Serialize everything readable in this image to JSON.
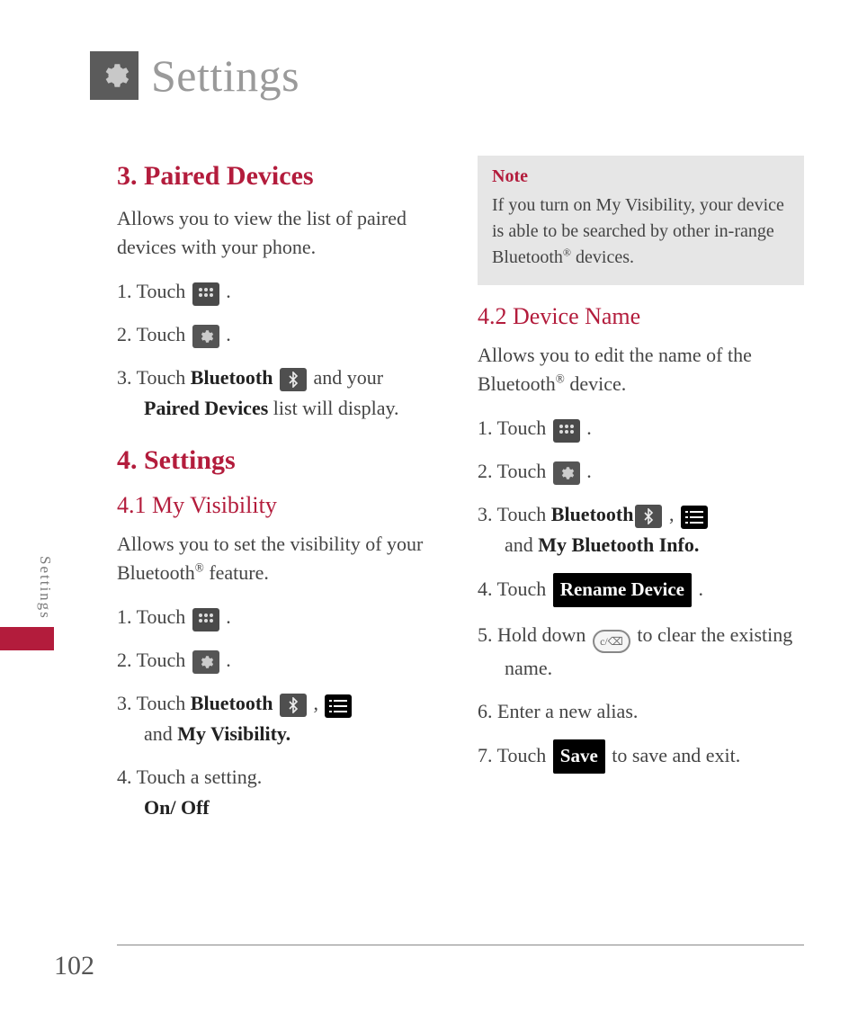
{
  "header": {
    "title": "Settings"
  },
  "sideTab": {
    "label": "Settings"
  },
  "pageNumber": "102",
  "left": {
    "section3": {
      "heading": "3. Paired Devices",
      "intro": "Allows you to view the list of paired devices with your phone.",
      "step1_a": "Touch ",
      "step1_b": " .",
      "step2_a": "Touch ",
      "step2_b": " .",
      "step3_a": "Touch ",
      "step3_bold1": "Bluetooth",
      "step3_b": " and your ",
      "step3_bold2": "Paired Devices",
      "step3_c": " list will display."
    },
    "section4": {
      "heading": "4. Settings",
      "sub41": "4.1 My Visibility",
      "intro41": "Allows you to set the visibility of your Bluetooth® feature.",
      "s41_1a": "Touch ",
      "s41_1b": " .",
      "s41_2a": "Touch ",
      "s41_2b": " .",
      "s41_3a": "Touch ",
      "s41_3bold": "Bluetooth",
      "s41_3b": " , ",
      "s41_3c": " and ",
      "s41_3bold2": "My Visibility.",
      "s41_4a": "Touch a setting.",
      "s41_4bold": "On/ Off"
    }
  },
  "right": {
    "note": {
      "title": "Note",
      "body": "If you turn on My Visibility, your device is able to be searched by other in-range Bluetooth® devices."
    },
    "sub42": "4.2 Device Name",
    "intro42": "Allows you to edit the name of the Bluetooth® device.",
    "s42_1a": "Touch ",
    "s42_1b": " .",
    "s42_2a": "Touch ",
    "s42_2b": " .",
    "s42_3a": "Touch ",
    "s42_3bold": "Bluetooth",
    "s42_3b": " , ",
    "s42_3c": " and ",
    "s42_3bold2": "My Bluetooth Info.",
    "s42_4a": "Touch ",
    "s42_4btn": "Rename Device",
    "s42_4b": " .",
    "s42_5a": "Hold down ",
    "s42_5key": "c/ ⌫",
    "s42_5b": " to clear the existing name.",
    "s42_6": "Enter a new alias.",
    "s42_7a": "Touch ",
    "s42_7btn": "Save",
    "s42_7b": " to save and exit."
  }
}
